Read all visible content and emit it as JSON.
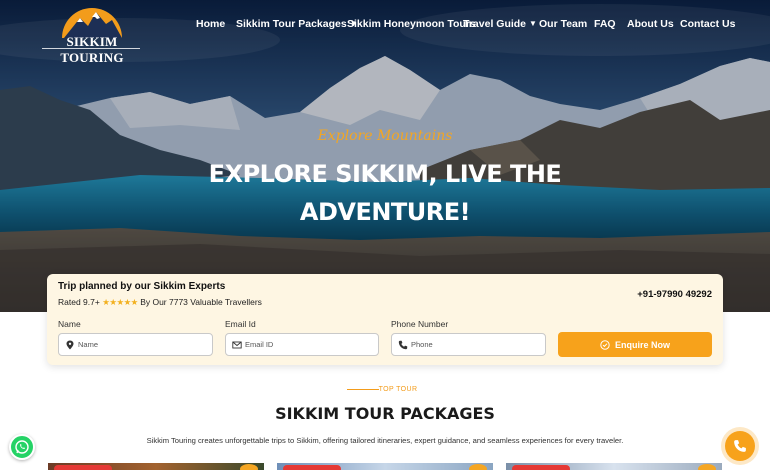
{
  "brand": {
    "name": "SIKKIM TOURING"
  },
  "nav": {
    "items": [
      {
        "label": "Home",
        "has_dropdown": false
      },
      {
        "label": "Sikkim Tour Packages",
        "has_dropdown": true
      },
      {
        "label": "Sikkim Honeymoon Tours",
        "has_dropdown": false
      },
      {
        "label": "Travel Guide",
        "has_dropdown": true
      },
      {
        "label": "Our Team",
        "has_dropdown": false
      },
      {
        "label": "FAQ",
        "has_dropdown": false
      },
      {
        "label": "About Us",
        "has_dropdown": false
      },
      {
        "label": "Contact Us",
        "has_dropdown": false
      }
    ]
  },
  "hero": {
    "kicker": "Explore Mountains",
    "headline": "EXPLORE SIKKIM, LIVE THE ADVENTURE!"
  },
  "enquiry": {
    "title": "Trip planned by our Sikkim Experts",
    "rating_prefix": "Rated 9.7+",
    "stars": "★★★★★",
    "rating_suffix": "By Our 7773 Valuable Travellers",
    "phone": "+91-97990 49292",
    "fields": {
      "name": {
        "label": "Name",
        "placeholder": "Name",
        "icon": "location-pin-icon"
      },
      "email": {
        "label": "Email Id",
        "placeholder": "Email ID",
        "icon": "envelope-icon"
      },
      "phone": {
        "label": "Phone Number",
        "placeholder": "Phone",
        "icon": "phone-icon"
      }
    },
    "button": {
      "label": "Enquire Now",
      "icon": "check-circle-icon"
    }
  },
  "section": {
    "kicker": "TOP TOUR",
    "title": "SIKKIM TOUR PACKAGES",
    "description": "Sikkim Touring creates unforgettable trips to Sikkim, offering tailored itineraries, expert guidance, and seamless experiences for every traveler."
  },
  "colors": {
    "accent": "#f7a21b",
    "whatsapp": "#25d366",
    "card_bg": "#fef6e3"
  }
}
